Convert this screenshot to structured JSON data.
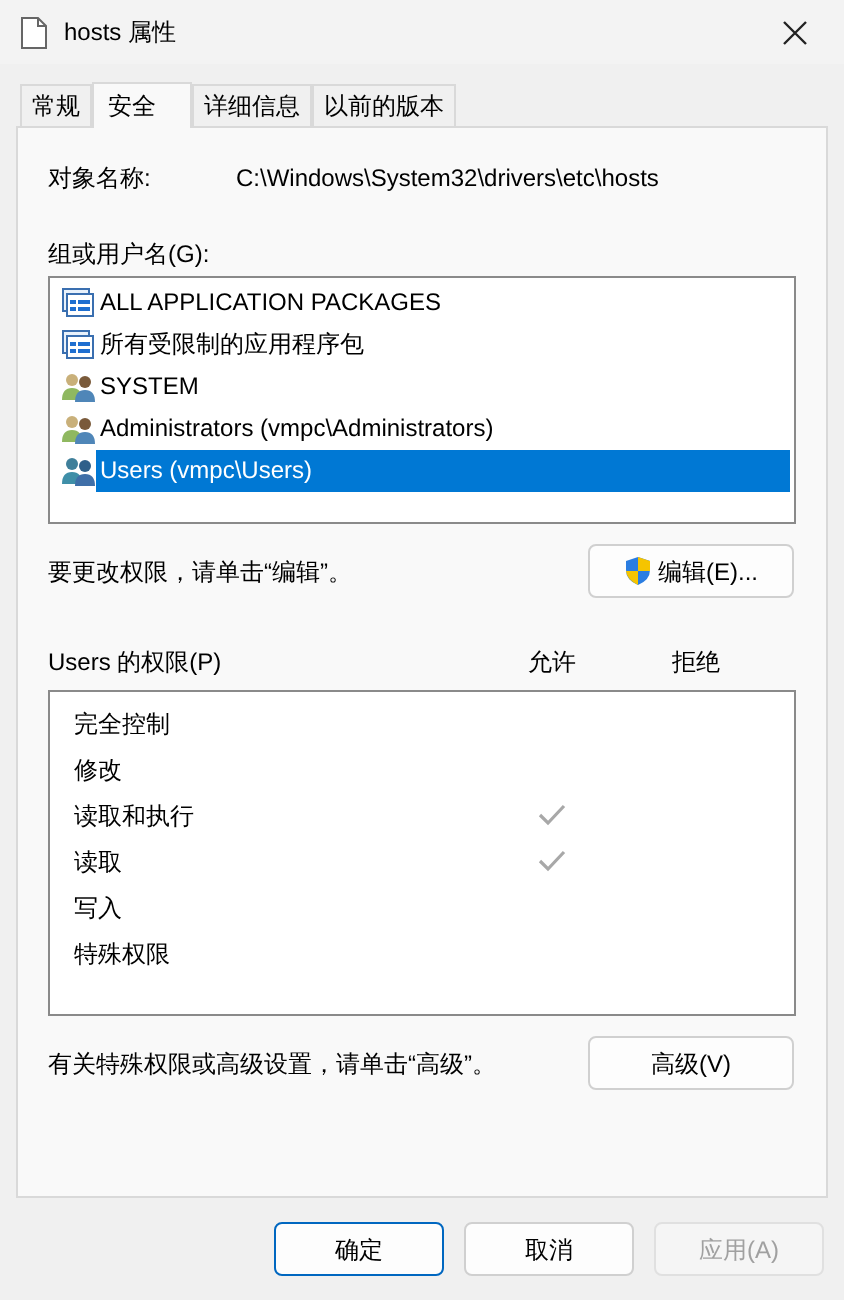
{
  "window": {
    "title": "hosts 属性"
  },
  "tabs": [
    {
      "label": "常规",
      "selected": false
    },
    {
      "label": "安全",
      "selected": true
    },
    {
      "label": "详细信息",
      "selected": false
    },
    {
      "label": "以前的版本",
      "selected": false
    }
  ],
  "object_name": {
    "label": "对象名称:",
    "value": "C:\\Windows\\System32\\drivers\\etc\\hosts"
  },
  "groups": {
    "label": "组或用户名(G):",
    "items": [
      {
        "name": "ALL APPLICATION PACKAGES",
        "kind": "package",
        "selected": false
      },
      {
        "name": "所有受限制的应用程序包",
        "kind": "package",
        "selected": false
      },
      {
        "name": "SYSTEM",
        "kind": "admin",
        "selected": false
      },
      {
        "name": "Administrators (vmpc\\Administrators)",
        "kind": "admin",
        "selected": false
      },
      {
        "name": "Users (vmpc\\Users)",
        "kind": "users",
        "selected": true
      }
    ]
  },
  "edit_hint": "要更改权限，请单击“编辑”。",
  "edit_button": "编辑(E)...",
  "permissions": {
    "label": "Users 的权限(P)",
    "allow_header": "允许",
    "deny_header": "拒绝",
    "rows": [
      {
        "name": "完全控制",
        "allow": false
      },
      {
        "name": "修改",
        "allow": false
      },
      {
        "name": "读取和执行",
        "allow": true
      },
      {
        "name": "读取",
        "allow": true
      },
      {
        "name": "写入",
        "allow": false
      },
      {
        "name": "特殊权限",
        "allow": false
      }
    ]
  },
  "advanced_hint": "有关特殊权限或高级设置，请单击“高级”。",
  "advanced_button": "高级(V)",
  "buttons": [
    {
      "label": "确定",
      "kind": "default",
      "disabled": false
    },
    {
      "label": "取消",
      "kind": "normal",
      "disabled": false
    },
    {
      "label": "应用(A)",
      "kind": "normal",
      "disabled": true
    }
  ]
}
